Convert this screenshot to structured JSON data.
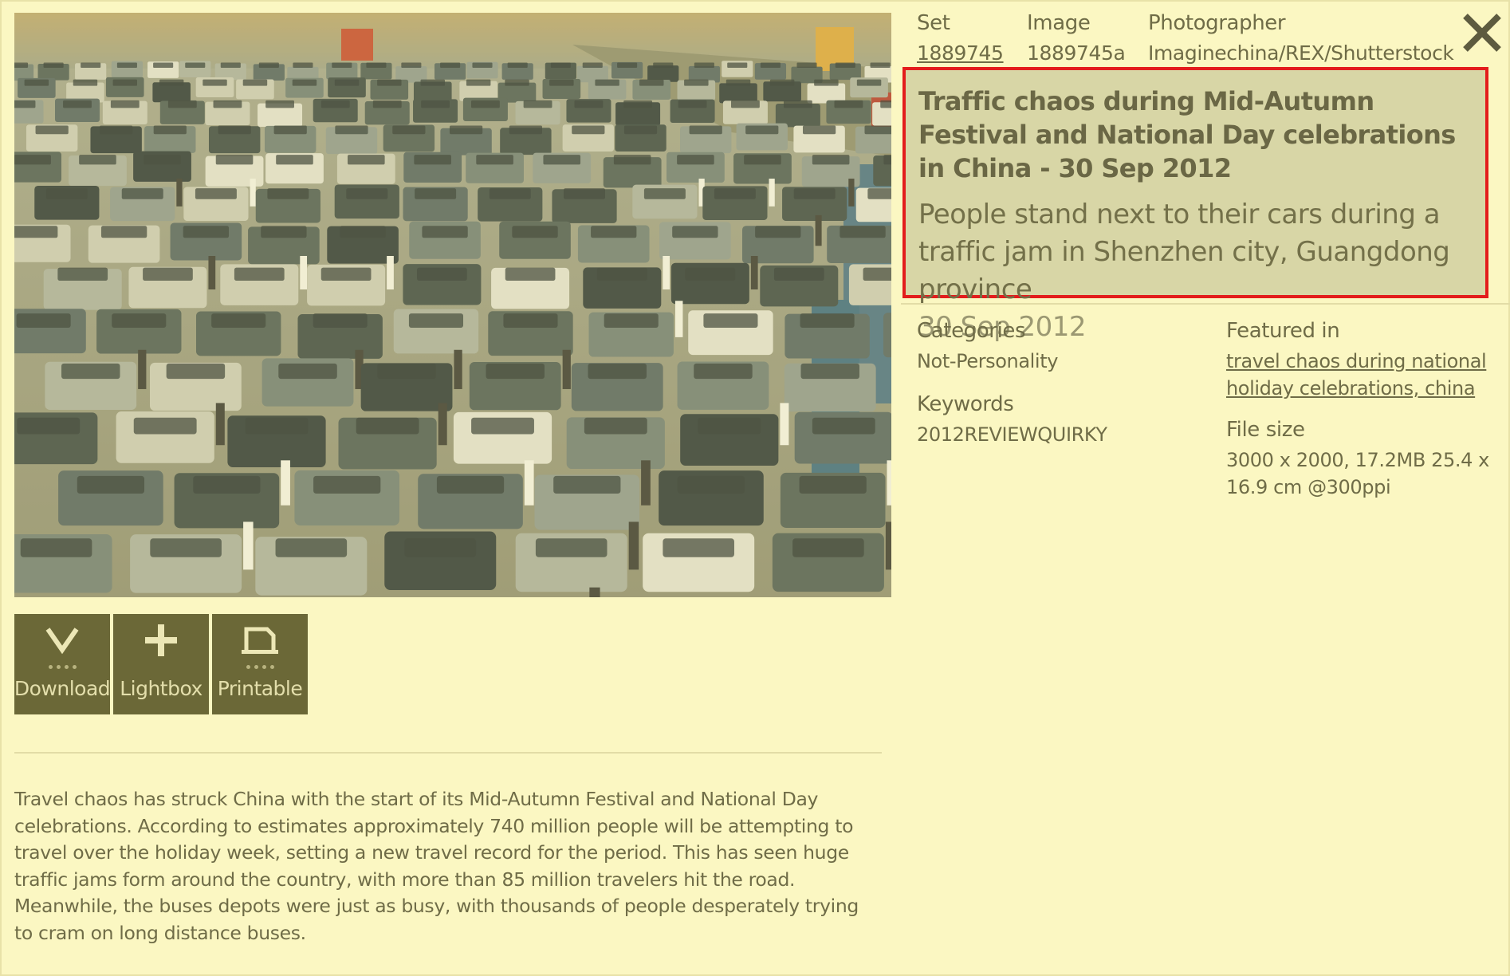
{
  "meta": {
    "set_label": "Set",
    "set_value": "1889745",
    "image_label": "Image",
    "image_value": "1889745a",
    "photographer_label": "Photographer",
    "photographer_value": "Imaginechina/REX/Shutterstock"
  },
  "caption": {
    "title": "Traffic chaos during Mid-Autumn Festival and National Day celebrations in China - 30 Sep 2012",
    "description": "People stand next to their cars during a traffic jam in Shenzhen city, Guangdong province",
    "date": "30 Sep 2012"
  },
  "details": {
    "categories_label": "Categories",
    "categories_value": "Not-Personality",
    "keywords_label": "Keywords",
    "keywords_value": "2012REVIEWQUIRKY",
    "featured_label": "Featured in",
    "featured_value": "travel chaos during national holiday celebrations, china",
    "filesize_label": "File size",
    "filesize_value": "3000 x 2000, 17.2MB 25.4 x 16.9 cm @300ppi"
  },
  "actions": {
    "download_label": "Download",
    "lightbox_label": "Lightbox",
    "printable_label": "Printable"
  },
  "description": "Travel chaos has struck China with the start of its Mid-Autumn Festival and National Day celebrations. According to estimates approximately 740 million people will be attempting to travel over the holiday week, setting a new travel record for the period. This has seen huge traffic jams form around the country, with more than 85 million travelers hit the road. Meanwhile, the buses depots were just as busy, with thousands of people desperately trying to cram on long distance buses.",
  "colors": {
    "background": "#fbf7c2",
    "button": "#6b6837",
    "caption_box": "#d8d6a6",
    "highlight_border": "#e31c1c",
    "text": "#6f6c47"
  },
  "icons": {
    "download": "chevron-down-icon",
    "lightbox": "plus-icon",
    "printable": "printer-icon",
    "close": "close-icon"
  }
}
